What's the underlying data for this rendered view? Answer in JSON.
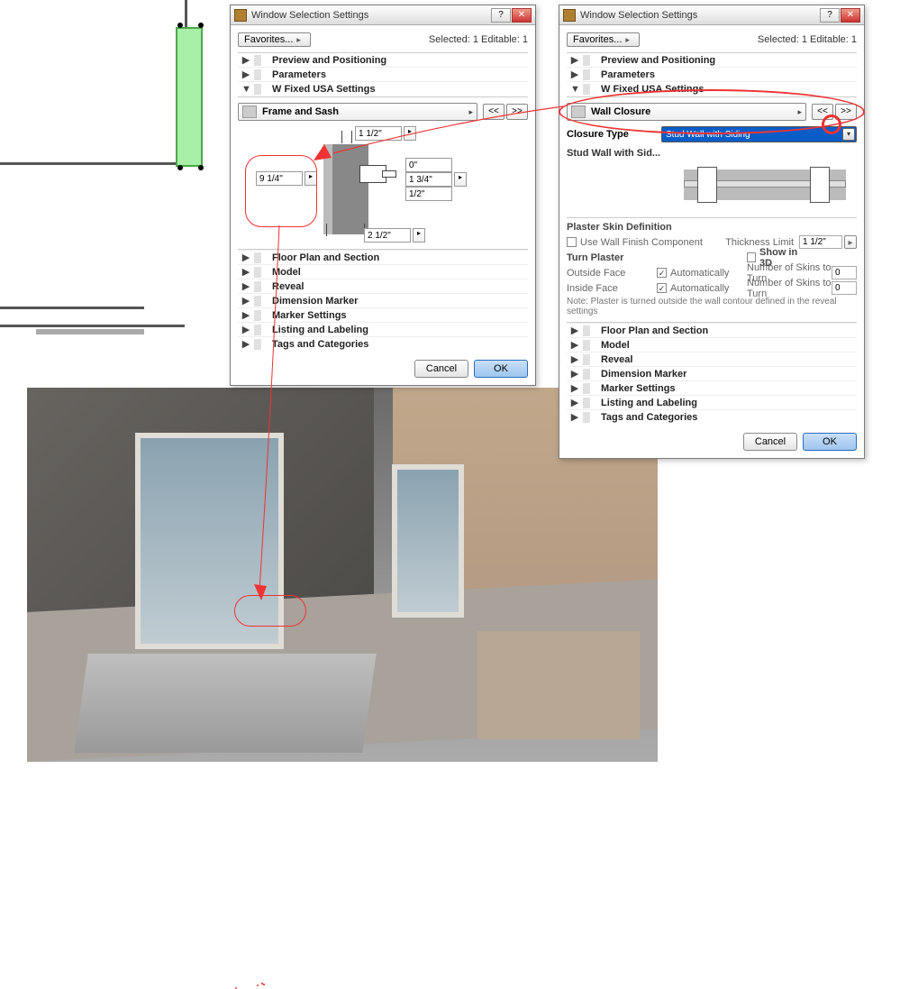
{
  "dialog_title": "Window Selection Settings",
  "favorites_label": "Favorites...",
  "selected_status": "Selected: 1 Editable: 1",
  "top_tree": [
    {
      "label": "Preview and Positioning",
      "expanded": false
    },
    {
      "label": "Parameters",
      "expanded": false
    },
    {
      "label": "W Fixed USA Settings",
      "expanded": true
    }
  ],
  "panel_left": {
    "name": "Frame and Sash",
    "dimensions": {
      "top": "1 1/2\"",
      "left": "9 1/4\"",
      "r0": "0\"",
      "r1": "1 3/4\"",
      "r2": "1/2\"",
      "bottom": "2 1/2\""
    }
  },
  "panel_right": {
    "name": "Wall Closure",
    "closure_type_label": "Closure Type",
    "closure_type_value": "Stud Wall with Siding",
    "stud_label": "Stud Wall with Sid...",
    "plaster": {
      "section_title": "Plaster Skin Definition",
      "use_wall_finish": "Use Wall Finish Component",
      "thickness_limit_label": "Thickness Limit",
      "thickness_limit_value": "1 1/2\"",
      "turn_title": "Turn Plaster",
      "show_in_3d": "Show in 3D",
      "outside": "Outside Face",
      "inside": "Inside Face",
      "auto": "Automatically",
      "skins_label": "Number of Skins to Turn",
      "skins_value": "0",
      "note": "Note: Plaster is turned outside the wall contour defined in the reveal settings"
    }
  },
  "nav_prev": "<<",
  "nav_next": ">>",
  "bottom_tree": [
    {
      "label": "Floor Plan and Section"
    },
    {
      "label": "Model"
    },
    {
      "label": "Reveal"
    },
    {
      "label": "Dimension Marker"
    },
    {
      "label": "Marker Settings"
    },
    {
      "label": "Listing and Labeling"
    },
    {
      "label": "Tags and Categories"
    }
  ],
  "btn_cancel": "Cancel",
  "btn_ok": "OK"
}
